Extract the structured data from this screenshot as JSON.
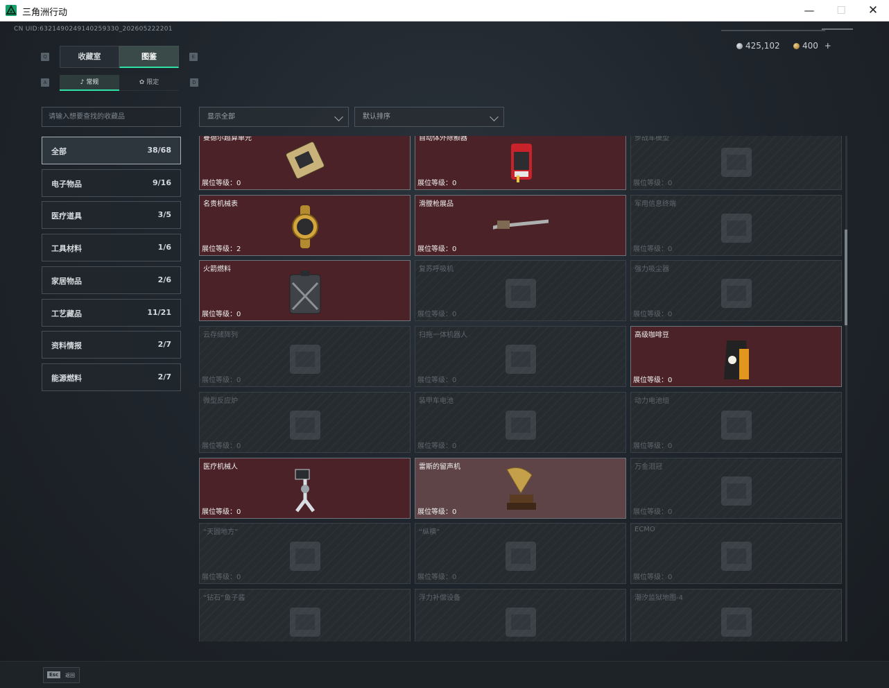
{
  "window": {
    "title": "三角洲行动",
    "minimize": "—",
    "maximize": "☐",
    "close": "✕"
  },
  "uid": "CN UID:6321490249140259330_202605222201",
  "currency": {
    "coins": "425,102",
    "tickets": "400",
    "add": "+"
  },
  "tabs": {
    "key_left": "Q",
    "key_right": "E",
    "items": [
      "收藏室",
      "图鉴"
    ],
    "active": 1
  },
  "subtabs": {
    "key_left": "A",
    "key_right": "D",
    "items": [
      "常规",
      "限定"
    ],
    "active": 0
  },
  "search": {
    "placeholder": "请输入想要查找的收藏品"
  },
  "filters": {
    "show": "显示全部",
    "sort": "默认排序"
  },
  "categories": [
    {
      "name": "全部",
      "count": "38/68"
    },
    {
      "name": "电子物品",
      "count": "9/16"
    },
    {
      "name": "医疗道具",
      "count": "3/5"
    },
    {
      "name": "工具材料",
      "count": "1/6"
    },
    {
      "name": "家居物品",
      "count": "2/6"
    },
    {
      "name": "工艺藏品",
      "count": "11/21"
    },
    {
      "name": "资料情报",
      "count": "2/7"
    },
    {
      "name": "能源燃料",
      "count": "2/7"
    }
  ],
  "level_label": "展位等级：",
  "items": [
    {
      "name": "曼德尔超算单元",
      "level": "0",
      "owned": true,
      "icon": "gpu-icon"
    },
    {
      "name": "自动体外除颤器",
      "level": "0",
      "owned": true,
      "icon": "defibrillator-icon"
    },
    {
      "name": "步战车模型",
      "level": "0",
      "owned": false,
      "icon": "ifv-model-icon"
    },
    {
      "name": "名贵机械表",
      "level": "2",
      "owned": true,
      "icon": "watch-icon"
    },
    {
      "name": "滑膛枪展品",
      "level": "0",
      "owned": true,
      "icon": "musket-icon"
    },
    {
      "name": "军用信息终端",
      "level": "0",
      "owned": false,
      "icon": "terminal-icon"
    },
    {
      "name": "火箭燃料",
      "level": "0",
      "owned": true,
      "icon": "fuel-can-icon"
    },
    {
      "name": "复苏呼吸机",
      "level": "0",
      "owned": false,
      "icon": "ventilator-icon"
    },
    {
      "name": "强力吸尘器",
      "level": "0",
      "owned": false,
      "icon": "vacuum-icon"
    },
    {
      "name": "云存储阵列",
      "level": "0",
      "owned": false,
      "icon": "storage-array-icon"
    },
    {
      "name": "扫拖一体机器人",
      "level": "0",
      "owned": false,
      "icon": "robot-mop-icon"
    },
    {
      "name": "高级咖啡豆",
      "level": "0",
      "owned": true,
      "icon": "coffee-bag-icon"
    },
    {
      "name": "微型反应炉",
      "level": "0",
      "owned": false,
      "icon": "reactor-icon"
    },
    {
      "name": "装甲车电池",
      "level": "0",
      "owned": false,
      "icon": "battery-icon"
    },
    {
      "name": "动力电池组",
      "level": "0",
      "owned": false,
      "icon": "battery-pack-icon"
    },
    {
      "name": "医疗机械人",
      "level": "0",
      "owned": true,
      "icon": "medical-robot-icon"
    },
    {
      "name": "雷斯的留声机",
      "level": "0",
      "owned": true,
      "icon": "gramophone-icon",
      "highlight": true
    },
    {
      "name": "万金泪冠",
      "level": "0",
      "owned": false,
      "icon": "crown-icon"
    },
    {
      "name": "“天圆地方”",
      "level": "0",
      "owned": false,
      "icon": "armillary-icon"
    },
    {
      "name": "“纵横”",
      "level": "0",
      "owned": false,
      "icon": "chessboard-icon"
    },
    {
      "name": "ECMO",
      "level": "0",
      "owned": false,
      "icon": "ecmo-icon"
    },
    {
      "name": "“钻石”鱼子酱",
      "level": "",
      "owned": false,
      "icon": "caviar-icon"
    },
    {
      "name": "浮力补偿设备",
      "level": "",
      "owned": false,
      "icon": "bcd-icon"
    },
    {
      "name": "潮汐监狱地图-4",
      "level": "",
      "owned": false,
      "icon": "map-icon"
    }
  ],
  "footer": {
    "key": "Esc",
    "label": "返回"
  }
}
